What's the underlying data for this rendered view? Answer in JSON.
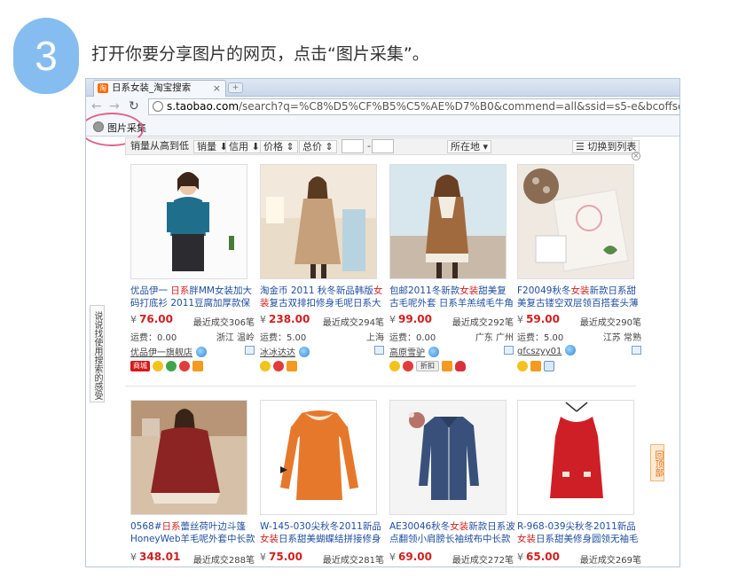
{
  "step": {
    "number": "3",
    "instruction": "打开你要分享图片的网页，点击“图片采集”。"
  },
  "browser": {
    "tab_title": "日系女装_淘宝搜索",
    "tab_icon_text": "淘",
    "url_host": "s.taobao.com",
    "url_path": "/search?q=%C8%D5%CF%B5%C5%AE%D7%B0&commend=all&ssid=s5-e&bcoffset=1&sort",
    "bookmark_label": "图片采集"
  },
  "sortbar": {
    "sort_desc": "销量从高到低",
    "sales": "销量",
    "credit": "信用",
    "price": "价格",
    "total_price": "总价",
    "dash": "-",
    "location": "所在地",
    "list_view": "切换到列表"
  },
  "feedback_label": "说说找使用搜索的感受",
  "back_top": "回顶部",
  "products": [
    {
      "title_pre": "优品伊一 ",
      "title_red": "日系",
      "title_post": "胖MM女装加大码打底衫 2011豆腐加厚款保暖高",
      "price": "76.00",
      "sold": "最近成交306笔",
      "shipping": "运费：0.00",
      "location": "浙江 温岭",
      "seller": "优品伊一旗舰店",
      "mall": "商城"
    },
    {
      "title_pre": "淘金币 2011 秋冬新品韩版",
      "title_red": "女装",
      "title_post": "复古双排扣修身毛呢日系大衣外",
      "price": "238.00",
      "sold": "最近成交294笔",
      "shipping": "运费：5.00",
      "location": "上海",
      "seller": "冰冰达达"
    },
    {
      "title_pre": "包邮2011冬新款",
      "title_red": "女装",
      "title_post": "甜美复古毛呢外套 日系羊羔绒毛牛角扣",
      "price": "99.00",
      "sold": "最近成交292笔",
      "shipping": "运费：0.00",
      "location": "广东 广州",
      "seller": "高原雪驴",
      "tag": "折扣"
    },
    {
      "title_pre": "F20049秋冬",
      "title_red": "女装",
      "title_post": "新款日系甜美复古镂空双层领百搭套头薄款打底针",
      "price": "59.00",
      "sold": "最近成交290笔",
      "shipping": "运费：5.00",
      "location": "江苏 常熟",
      "seller": "gfcszyy01"
    },
    {
      "title_pre": "0568#",
      "title_red": "日系",
      "title_post": "蕾丝荷叶边斗篷 HoneyWeb羊毛呢外套中长款保暖",
      "price": "348.01",
      "sold": "最近成交288笔"
    },
    {
      "title_pre": "W-145-030尖秋冬2011新品",
      "title_red": "女装",
      "title_post": "日系甜美蝴蝶结拼接修身长款",
      "price": "75.00",
      "sold": "最近成交281笔"
    },
    {
      "title_pre": "AE30046秋冬",
      "title_red": "女装",
      "title_post": "新款日系波点翻领小肩膀长袖绒布中长款衬衫",
      "price": "69.00",
      "sold": "最近成交272笔"
    },
    {
      "title_pre": "R-968-039尖秋冬2011新品",
      "title_red": "女装",
      "title_post": "日系甜美修身圆领无袖毛呢连衣",
      "price": "65.00",
      "sold": "最近成交269笔"
    }
  ],
  "currency": "¥",
  "colors": {
    "step_circle": "#86bdf0",
    "highlight_ring": "#e0648a",
    "price_red": "#d21f1f",
    "link_blue": "#1f4fa0",
    "taobao_orange": "#ff6a00"
  }
}
